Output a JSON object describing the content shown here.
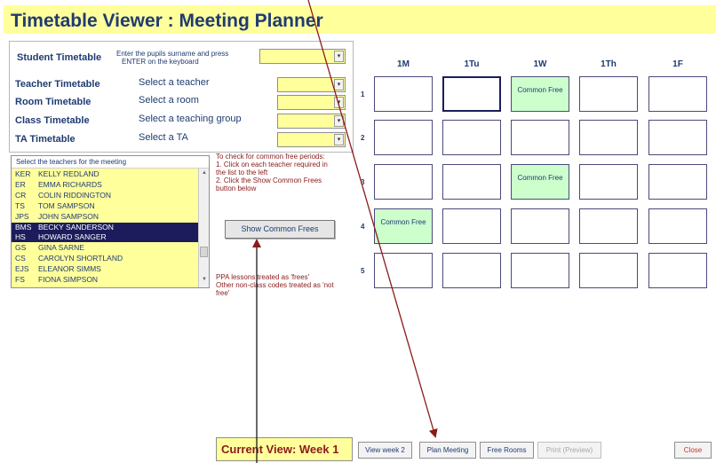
{
  "title": "Timetable Viewer : Meeting Planner",
  "panel": {
    "student_label": "Student Timetable",
    "student_hint_line1": "Enter the pupils surname and press",
    "student_hint_line2": "ENTER on the keyboard",
    "teacher_label": "Teacher Timetable",
    "teacher_prompt": "Select a teacher",
    "room_label": "Room Timetable",
    "room_prompt": "Select a room",
    "class_label": "Class Timetable",
    "class_prompt": "Select a teaching group",
    "ta_label": "TA Timetable",
    "ta_prompt": "Select a TA"
  },
  "teacher_list": {
    "header": "Select the teachers for the meeting",
    "rows": [
      {
        "code": "KER",
        "name": "KELLY REDLAND",
        "selected": false
      },
      {
        "code": "ER",
        "name": "EMMA RICHARDS",
        "selected": false
      },
      {
        "code": "CR",
        "name": "COLIN RIDDINGTON",
        "selected": false
      },
      {
        "code": "TS",
        "name": "TOM SAMPSON",
        "selected": false
      },
      {
        "code": "JPS",
        "name": "JOHN SAMPSON",
        "selected": false
      },
      {
        "code": "BMS",
        "name": "BECKY SANDERSON",
        "selected": true
      },
      {
        "code": "HS",
        "name": "HOWARD SANGER",
        "selected": true
      },
      {
        "code": "GS",
        "name": "GINA SARNE",
        "selected": false
      },
      {
        "code": "CS",
        "name": "CAROLYN SHORTLAND",
        "selected": false
      },
      {
        "code": "EJS",
        "name": "ELEANOR SIMMS",
        "selected": false
      },
      {
        "code": "FS",
        "name": "FIONA SIMPSON",
        "selected": false
      }
    ]
  },
  "instructions": {
    "l1": "To check for common free periods:",
    "l2": "1. Click on each teacher required in",
    "l3": "the list to the left",
    "l4": "2. Click the Show Common Frees",
    "l5": "button below"
  },
  "show_button": "Show Common Frees",
  "notes": {
    "l1": "PPA lessons treated as 'frees'",
    "l2": "Other non-class codes treated as 'not",
    "l3": "free'"
  },
  "grid": {
    "columns": [
      "1M",
      "1Tu",
      "1W",
      "1Th",
      "1F"
    ],
    "rows": [
      "1",
      "2",
      "3",
      "4",
      "5"
    ],
    "common_free_label": "Common Free",
    "free_cells": [
      [
        0,
        2
      ],
      [
        2,
        2
      ],
      [
        3,
        0
      ]
    ],
    "focused_cell": [
      0,
      1
    ]
  },
  "bottom": {
    "current_view": "Current View:  Week 1",
    "view_week2": "View week 2",
    "plan_meeting": "Plan Meeting",
    "free_rooms": "Free Rooms",
    "print_preview": "Print (Preview)",
    "close": "Close"
  },
  "colors": {
    "title_bg": "#ffff9c",
    "title_text": "#1f3b73",
    "selected_row": "#1c1c5c",
    "free_cell": "#ccffcc",
    "annotation_arrow": "#8b1a1a"
  }
}
